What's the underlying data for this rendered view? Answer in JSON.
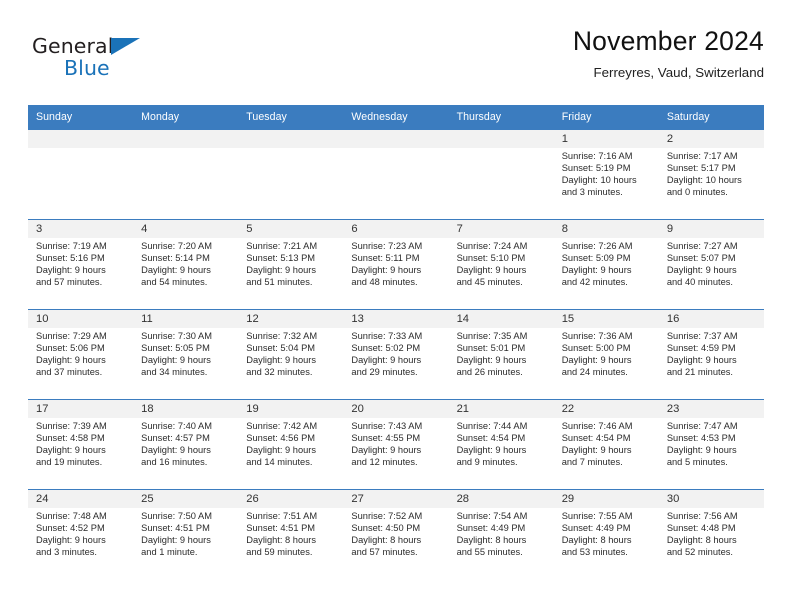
{
  "brand": {
    "name_primary": "General",
    "name_secondary": "Blue",
    "triangle_icon": "triangle-icon",
    "primary_color": "#231f20",
    "accent_color": "#1a72b8"
  },
  "header": {
    "title": "November 2024",
    "subtitle": "Ferreyres, Vaud, Switzerland"
  },
  "theme": {
    "header_blue": "#3b7cbf",
    "daynum_band": "#f2f2f2",
    "cell_background": "#ffffff",
    "text": "#2b2b2b"
  },
  "calendar": {
    "weekday_headers": [
      "Sunday",
      "Monday",
      "Tuesday",
      "Wednesday",
      "Thursday",
      "Friday",
      "Saturday"
    ],
    "weeks": [
      [
        {
          "day": "",
          "empty": true
        },
        {
          "day": "",
          "empty": true
        },
        {
          "day": "",
          "empty": true
        },
        {
          "day": "",
          "empty": true
        },
        {
          "day": "",
          "empty": true
        },
        {
          "day": "1",
          "sunrise": "Sunrise: 7:16 AM",
          "sunset": "Sunset: 5:19 PM",
          "daylight_1": "Daylight: 10 hours",
          "daylight_2": "and 3 minutes."
        },
        {
          "day": "2",
          "sunrise": "Sunrise: 7:17 AM",
          "sunset": "Sunset: 5:17 PM",
          "daylight_1": "Daylight: 10 hours",
          "daylight_2": "and 0 minutes."
        }
      ],
      [
        {
          "day": "3",
          "sunrise": "Sunrise: 7:19 AM",
          "sunset": "Sunset: 5:16 PM",
          "daylight_1": "Daylight: 9 hours",
          "daylight_2": "and 57 minutes."
        },
        {
          "day": "4",
          "sunrise": "Sunrise: 7:20 AM",
          "sunset": "Sunset: 5:14 PM",
          "daylight_1": "Daylight: 9 hours",
          "daylight_2": "and 54 minutes."
        },
        {
          "day": "5",
          "sunrise": "Sunrise: 7:21 AM",
          "sunset": "Sunset: 5:13 PM",
          "daylight_1": "Daylight: 9 hours",
          "daylight_2": "and 51 minutes."
        },
        {
          "day": "6",
          "sunrise": "Sunrise: 7:23 AM",
          "sunset": "Sunset: 5:11 PM",
          "daylight_1": "Daylight: 9 hours",
          "daylight_2": "and 48 minutes."
        },
        {
          "day": "7",
          "sunrise": "Sunrise: 7:24 AM",
          "sunset": "Sunset: 5:10 PM",
          "daylight_1": "Daylight: 9 hours",
          "daylight_2": "and 45 minutes."
        },
        {
          "day": "8",
          "sunrise": "Sunrise: 7:26 AM",
          "sunset": "Sunset: 5:09 PM",
          "daylight_1": "Daylight: 9 hours",
          "daylight_2": "and 42 minutes."
        },
        {
          "day": "9",
          "sunrise": "Sunrise: 7:27 AM",
          "sunset": "Sunset: 5:07 PM",
          "daylight_1": "Daylight: 9 hours",
          "daylight_2": "and 40 minutes."
        }
      ],
      [
        {
          "day": "10",
          "sunrise": "Sunrise: 7:29 AM",
          "sunset": "Sunset: 5:06 PM",
          "daylight_1": "Daylight: 9 hours",
          "daylight_2": "and 37 minutes."
        },
        {
          "day": "11",
          "sunrise": "Sunrise: 7:30 AM",
          "sunset": "Sunset: 5:05 PM",
          "daylight_1": "Daylight: 9 hours",
          "daylight_2": "and 34 minutes."
        },
        {
          "day": "12",
          "sunrise": "Sunrise: 7:32 AM",
          "sunset": "Sunset: 5:04 PM",
          "daylight_1": "Daylight: 9 hours",
          "daylight_2": "and 32 minutes."
        },
        {
          "day": "13",
          "sunrise": "Sunrise: 7:33 AM",
          "sunset": "Sunset: 5:02 PM",
          "daylight_1": "Daylight: 9 hours",
          "daylight_2": "and 29 minutes."
        },
        {
          "day": "14",
          "sunrise": "Sunrise: 7:35 AM",
          "sunset": "Sunset: 5:01 PM",
          "daylight_1": "Daylight: 9 hours",
          "daylight_2": "and 26 minutes."
        },
        {
          "day": "15",
          "sunrise": "Sunrise: 7:36 AM",
          "sunset": "Sunset: 5:00 PM",
          "daylight_1": "Daylight: 9 hours",
          "daylight_2": "and 24 minutes."
        },
        {
          "day": "16",
          "sunrise": "Sunrise: 7:37 AM",
          "sunset": "Sunset: 4:59 PM",
          "daylight_1": "Daylight: 9 hours",
          "daylight_2": "and 21 minutes."
        }
      ],
      [
        {
          "day": "17",
          "sunrise": "Sunrise: 7:39 AM",
          "sunset": "Sunset: 4:58 PM",
          "daylight_1": "Daylight: 9 hours",
          "daylight_2": "and 19 minutes."
        },
        {
          "day": "18",
          "sunrise": "Sunrise: 7:40 AM",
          "sunset": "Sunset: 4:57 PM",
          "daylight_1": "Daylight: 9 hours",
          "daylight_2": "and 16 minutes."
        },
        {
          "day": "19",
          "sunrise": "Sunrise: 7:42 AM",
          "sunset": "Sunset: 4:56 PM",
          "daylight_1": "Daylight: 9 hours",
          "daylight_2": "and 14 minutes."
        },
        {
          "day": "20",
          "sunrise": "Sunrise: 7:43 AM",
          "sunset": "Sunset: 4:55 PM",
          "daylight_1": "Daylight: 9 hours",
          "daylight_2": "and 12 minutes."
        },
        {
          "day": "21",
          "sunrise": "Sunrise: 7:44 AM",
          "sunset": "Sunset: 4:54 PM",
          "daylight_1": "Daylight: 9 hours",
          "daylight_2": "and 9 minutes."
        },
        {
          "day": "22",
          "sunrise": "Sunrise: 7:46 AM",
          "sunset": "Sunset: 4:54 PM",
          "daylight_1": "Daylight: 9 hours",
          "daylight_2": "and 7 minutes."
        },
        {
          "day": "23",
          "sunrise": "Sunrise: 7:47 AM",
          "sunset": "Sunset: 4:53 PM",
          "daylight_1": "Daylight: 9 hours",
          "daylight_2": "and 5 minutes."
        }
      ],
      [
        {
          "day": "24",
          "sunrise": "Sunrise: 7:48 AM",
          "sunset": "Sunset: 4:52 PM",
          "daylight_1": "Daylight: 9 hours",
          "daylight_2": "and 3 minutes."
        },
        {
          "day": "25",
          "sunrise": "Sunrise: 7:50 AM",
          "sunset": "Sunset: 4:51 PM",
          "daylight_1": "Daylight: 9 hours",
          "daylight_2": "and 1 minute."
        },
        {
          "day": "26",
          "sunrise": "Sunrise: 7:51 AM",
          "sunset": "Sunset: 4:51 PM",
          "daylight_1": "Daylight: 8 hours",
          "daylight_2": "and 59 minutes."
        },
        {
          "day": "27",
          "sunrise": "Sunrise: 7:52 AM",
          "sunset": "Sunset: 4:50 PM",
          "daylight_1": "Daylight: 8 hours",
          "daylight_2": "and 57 minutes."
        },
        {
          "day": "28",
          "sunrise": "Sunrise: 7:54 AM",
          "sunset": "Sunset: 4:49 PM",
          "daylight_1": "Daylight: 8 hours",
          "daylight_2": "and 55 minutes."
        },
        {
          "day": "29",
          "sunrise": "Sunrise: 7:55 AM",
          "sunset": "Sunset: 4:49 PM",
          "daylight_1": "Daylight: 8 hours",
          "daylight_2": "and 53 minutes."
        },
        {
          "day": "30",
          "sunrise": "Sunrise: 7:56 AM",
          "sunset": "Sunset: 4:48 PM",
          "daylight_1": "Daylight: 8 hours",
          "daylight_2": "and 52 minutes."
        }
      ]
    ]
  }
}
